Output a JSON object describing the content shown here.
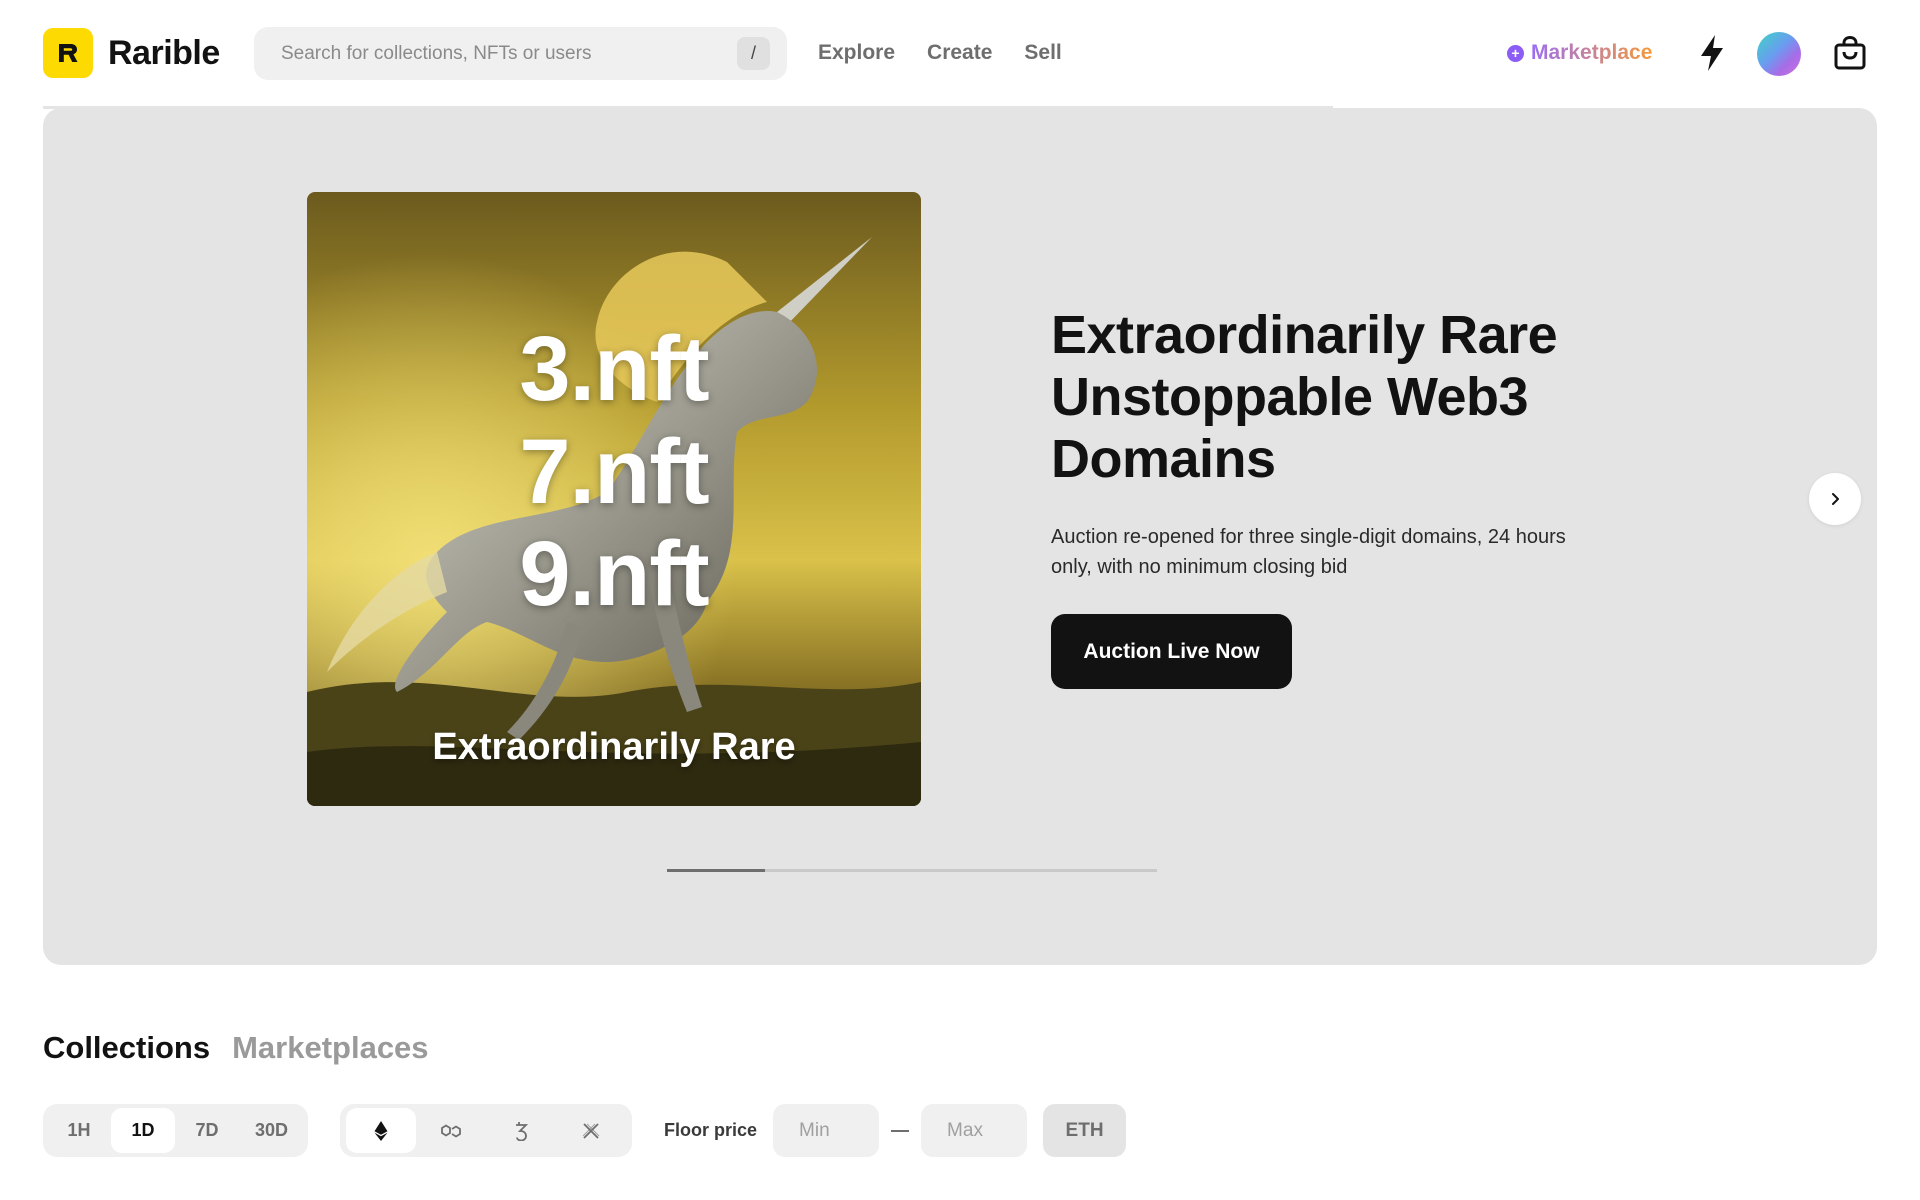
{
  "header": {
    "brand": "Rarible",
    "search": {
      "placeholder": "Search for collections, NFTs or users",
      "shortcut": "/"
    },
    "nav": [
      {
        "label": "Explore"
      },
      {
        "label": "Create"
      },
      {
        "label": "Sell"
      }
    ],
    "marketplace_label": "Marketplace",
    "icons": [
      "bolt-icon",
      "avatar",
      "shopping-bag-icon"
    ]
  },
  "hero": {
    "art": {
      "lines": [
        "3.nft",
        "7.nft",
        "9.nft"
      ],
      "caption": "Extraordinarily Rare"
    },
    "title": "Extraordinarily Rare Unstoppable Web3 Domains",
    "description": "Auction re-opened for three single-digit domains, 24 hours only, with no minimum closing bid",
    "cta_label": "Auction Live Now",
    "slides_total": 5,
    "active_slide": 1
  },
  "collections": {
    "tabs": [
      {
        "label": "Collections",
        "active": true
      },
      {
        "label": "Marketplaces",
        "active": false
      }
    ],
    "time_filters": [
      {
        "label": "1H",
        "active": false
      },
      {
        "label": "1D",
        "active": true
      },
      {
        "label": "7D",
        "active": false
      },
      {
        "label": "30D",
        "active": false
      }
    ],
    "chain_filters": [
      {
        "icon": "ethereum-icon",
        "active": true
      },
      {
        "icon": "polygon-icon",
        "active": false
      },
      {
        "icon": "tezos-icon",
        "active": false
      },
      {
        "icon": "immutable-x-icon",
        "active": false
      }
    ],
    "floor_price_label": "Floor price",
    "min_placeholder": "Min",
    "max_placeholder": "Max",
    "currency": "ETH"
  },
  "colors": {
    "brand_yellow": "#FEDA03",
    "primary_dark": "#121212",
    "hero_bg": "#E4E4E4",
    "marketplace_gradient_start": "#9B6EF3",
    "marketplace_gradient_end": "#F49A3B"
  }
}
